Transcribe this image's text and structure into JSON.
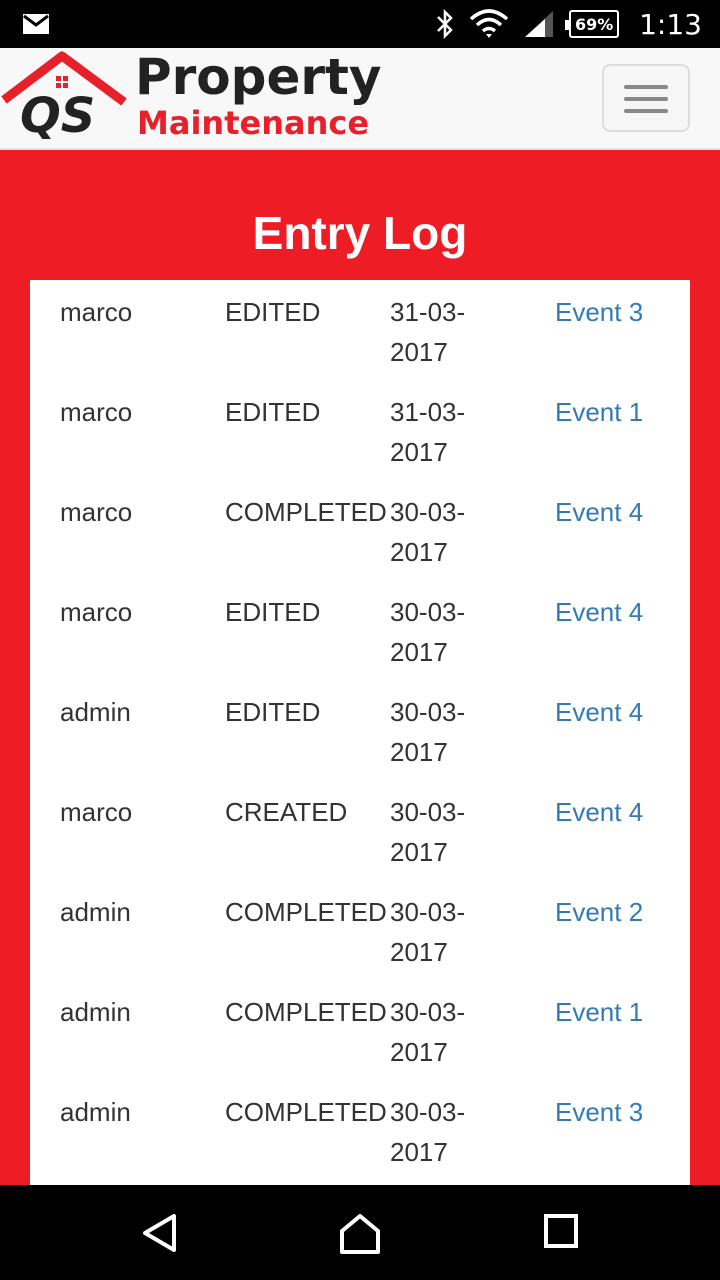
{
  "status_bar": {
    "icons": [
      "mail-icon",
      "bluetooth-icon",
      "wifi-icon",
      "signal-icon"
    ],
    "battery": "69%",
    "time": "1:13"
  },
  "header": {
    "brand_line1": "Property",
    "brand_line2": "Maintenance",
    "brand_mark": "QS",
    "menu_icon": "hamburger-icon",
    "colors": {
      "brand_red": "#e8202a",
      "dark": "#222222"
    }
  },
  "page": {
    "title": "Entry Log",
    "background_color": "#ee1c25",
    "link_color": "#337ab7"
  },
  "entries": [
    {
      "user": "marco",
      "action": "EDITED",
      "date": "31-03-2017",
      "event": "Event 3"
    },
    {
      "user": "marco",
      "action": "EDITED",
      "date": "31-03-2017",
      "event": "Event 1"
    },
    {
      "user": "marco",
      "action": "COMPLETED",
      "date": "30-03-2017",
      "event": "Event 4"
    },
    {
      "user": "marco",
      "action": "EDITED",
      "date": "30-03-2017",
      "event": "Event 4"
    },
    {
      "user": "admin",
      "action": "EDITED",
      "date": "30-03-2017",
      "event": "Event 4"
    },
    {
      "user": "marco",
      "action": "CREATED",
      "date": "30-03-2017",
      "event": "Event 4"
    },
    {
      "user": "admin",
      "action": "COMPLETED",
      "date": "30-03-2017",
      "event": "Event 2"
    },
    {
      "user": "admin",
      "action": "COMPLETED",
      "date": "30-03-2017",
      "event": "Event 1"
    },
    {
      "user": "admin",
      "action": "COMPLETED",
      "date": "30-03-2017",
      "event": "Event 3"
    }
  ],
  "nav_bar": {
    "icons": [
      "back-icon",
      "home-icon",
      "recents-icon"
    ]
  }
}
